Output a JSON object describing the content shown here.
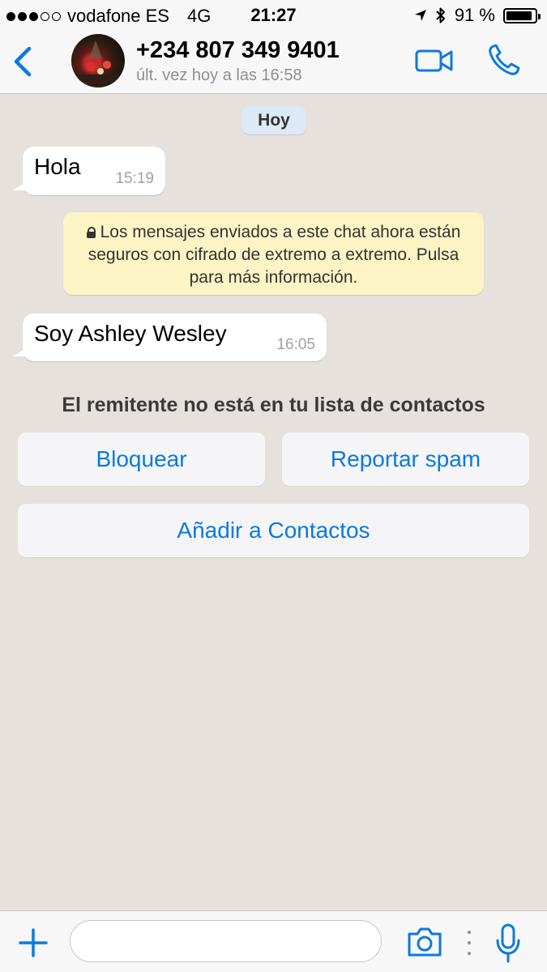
{
  "status_bar": {
    "carrier": "vodafone ES",
    "network": "4G",
    "time": "21:27",
    "battery": "91 %",
    "battery_level": 0.91,
    "signal_bars_filled": 3,
    "signal_bars_total": 5
  },
  "header": {
    "contact_name": "+234 807 349 9401",
    "last_seen": "últ. vez hoy a las 16:58",
    "icons": [
      "back-chevron-icon",
      "video-call-icon",
      "phone-call-icon"
    ]
  },
  "chat": {
    "date_label": "Hoy",
    "messages": [
      {
        "text": "Hola",
        "time": "15:19"
      },
      {
        "text": "Soy Ashley Wesley",
        "time": "16:05"
      }
    ],
    "encryption_notice": "Los mensajes enviados a este chat ahora están seguros con cifrado de extremo a extremo. Pulsa para más información.",
    "sender_notice": "El remitente no está en tu lista de contactos",
    "actions": {
      "block": "Bloquear",
      "report_spam": "Reportar spam",
      "add_contact": "Añadir a Contactos"
    }
  },
  "input_bar": {
    "placeholder": "",
    "icons": [
      "plus-icon",
      "camera-icon",
      "more-dots-icon",
      "microphone-icon"
    ]
  },
  "colors": {
    "accent": "#0a7ae0",
    "chat_background": "#e6e1dc",
    "encryption_background": "#fdf4c5",
    "date_pill": "#dde9f7"
  }
}
